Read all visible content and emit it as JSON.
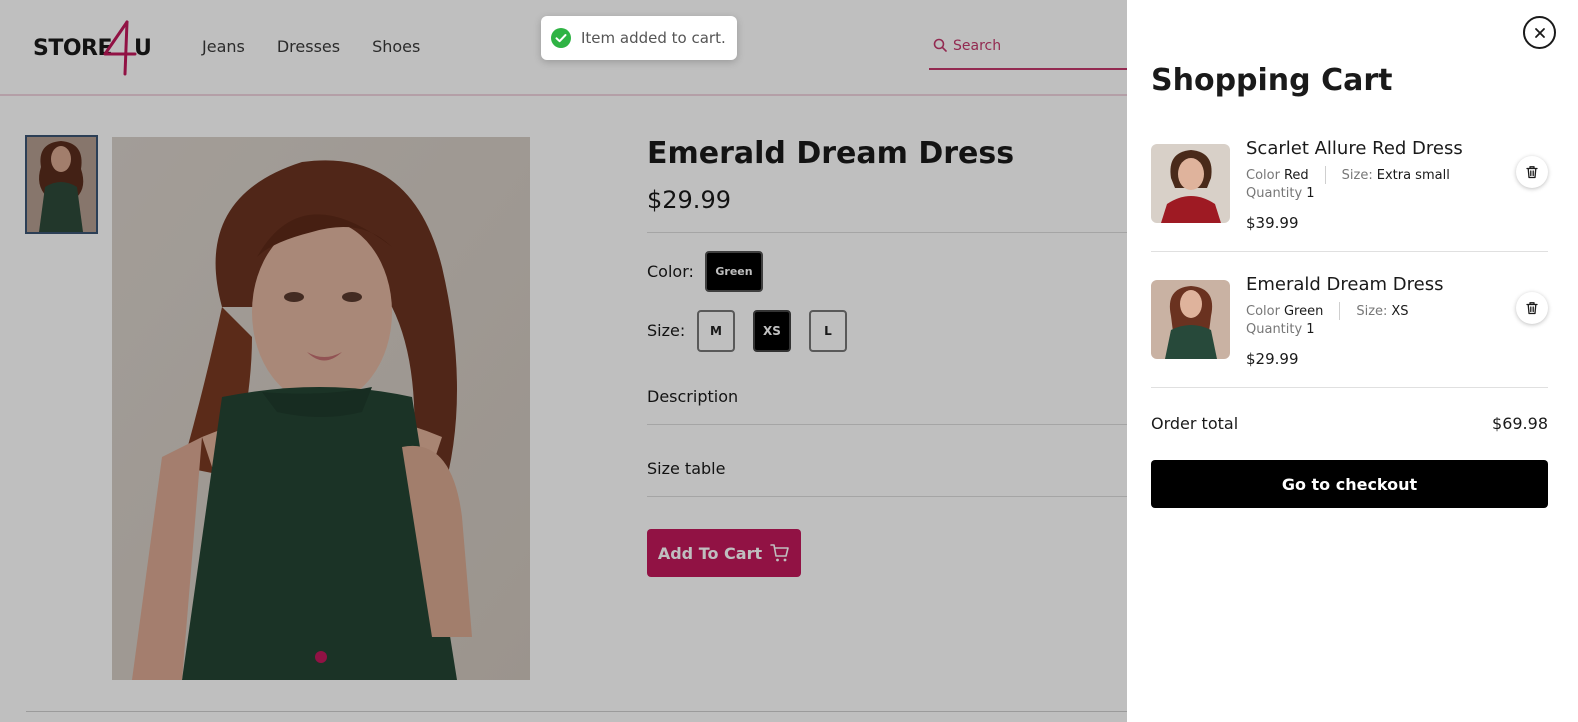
{
  "header": {
    "logo_text_left": "STORE",
    "logo_text_four": "4",
    "logo_text_right": "U",
    "nav": [
      "Jeans",
      "Dresses",
      "Shoes"
    ],
    "search_placeholder": "Search"
  },
  "toast": {
    "message": "Item added to cart.",
    "icon": "check-circle-icon",
    "icon_color": "#2fb344"
  },
  "product": {
    "title": "Emerald Dream Dress",
    "price": "$29.99",
    "color_label": "Color:",
    "color_value": "Green",
    "size_label": "Size:",
    "sizes": [
      "M",
      "XS",
      "L"
    ],
    "selected_size": "XS",
    "description_label": "Description",
    "size_table_label": "Size table",
    "add_to_cart_label": "Add To Cart",
    "accent_color": "#c2185b"
  },
  "cart": {
    "title": "Shopping Cart",
    "items": [
      {
        "name": "Scarlet Allure Red Dress",
        "color_label": "Color",
        "color": "Red",
        "size_label": "Size:",
        "size": "Extra small",
        "qty_label": "Quantity",
        "qty": "1",
        "price": "$39.99"
      },
      {
        "name": "Emerald Dream Dress",
        "color_label": "Color",
        "color": "Green",
        "size_label": "Size:",
        "size": "XS",
        "qty_label": "Quantity",
        "qty": "1",
        "price": "$29.99"
      }
    ],
    "order_total_label": "Order total",
    "order_total_value": "$69.98",
    "checkout_label": "Go to checkout"
  }
}
